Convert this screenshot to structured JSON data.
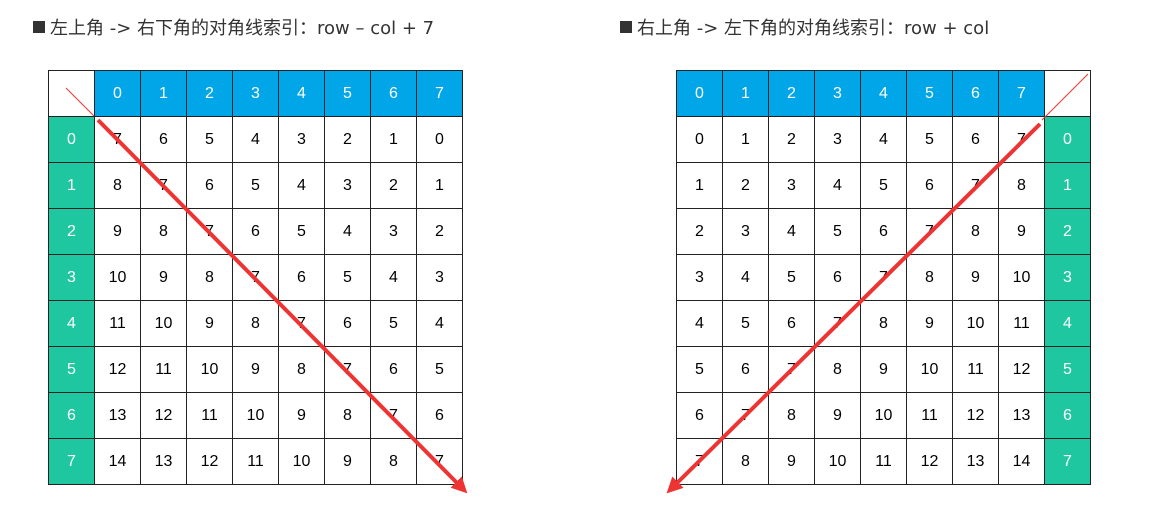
{
  "left": {
    "title": "左上角 -> 右下角的对角线索引：row – col + 7",
    "col_headers": [
      "0",
      "1",
      "2",
      "3",
      "4",
      "5",
      "6",
      "7"
    ],
    "row_headers": [
      "0",
      "1",
      "2",
      "3",
      "4",
      "5",
      "6",
      "7"
    ],
    "cells": [
      [
        "7",
        "6",
        "5",
        "4",
        "3",
        "2",
        "1",
        "0"
      ],
      [
        "8",
        "7",
        "6",
        "5",
        "4",
        "3",
        "2",
        "1"
      ],
      [
        "9",
        "8",
        "7",
        "6",
        "5",
        "4",
        "3",
        "2"
      ],
      [
        "10",
        "9",
        "8",
        "7",
        "6",
        "5",
        "4",
        "3"
      ],
      [
        "11",
        "10",
        "9",
        "8",
        "7",
        "6",
        "5",
        "4"
      ],
      [
        "12",
        "11",
        "10",
        "9",
        "8",
        "7",
        "6",
        "5"
      ],
      [
        "13",
        "12",
        "11",
        "10",
        "9",
        "8",
        "7",
        "6"
      ],
      [
        "14",
        "13",
        "12",
        "11",
        "10",
        "9",
        "8",
        "7"
      ]
    ]
  },
  "right": {
    "title": "右上角 -> 左下角的对角线索引：row + col",
    "col_headers": [
      "0",
      "1",
      "2",
      "3",
      "4",
      "5",
      "6",
      "7"
    ],
    "row_headers": [
      "0",
      "1",
      "2",
      "3",
      "4",
      "5",
      "6",
      "7"
    ],
    "cells": [
      [
        "0",
        "1",
        "2",
        "3",
        "4",
        "5",
        "6",
        "7"
      ],
      [
        "1",
        "2",
        "3",
        "4",
        "5",
        "6",
        "7",
        "8"
      ],
      [
        "2",
        "3",
        "4",
        "5",
        "6",
        "7",
        "8",
        "9"
      ],
      [
        "3",
        "4",
        "5",
        "6",
        "7",
        "8",
        "9",
        "10"
      ],
      [
        "4",
        "5",
        "6",
        "7",
        "8",
        "9",
        "10",
        "11"
      ],
      [
        "5",
        "6",
        "7",
        "8",
        "9",
        "10",
        "11",
        "12"
      ],
      [
        "6",
        "7",
        "8",
        "9",
        "10",
        "11",
        "12",
        "13"
      ],
      [
        "7",
        "8",
        "9",
        "10",
        "11",
        "12",
        "13",
        "14"
      ]
    ]
  },
  "colors": {
    "col_header_bg": "#00a6e8",
    "row_header_bg": "#1fc7a1",
    "arrow": "#ee3333",
    "thin_line": "#ee3333"
  }
}
